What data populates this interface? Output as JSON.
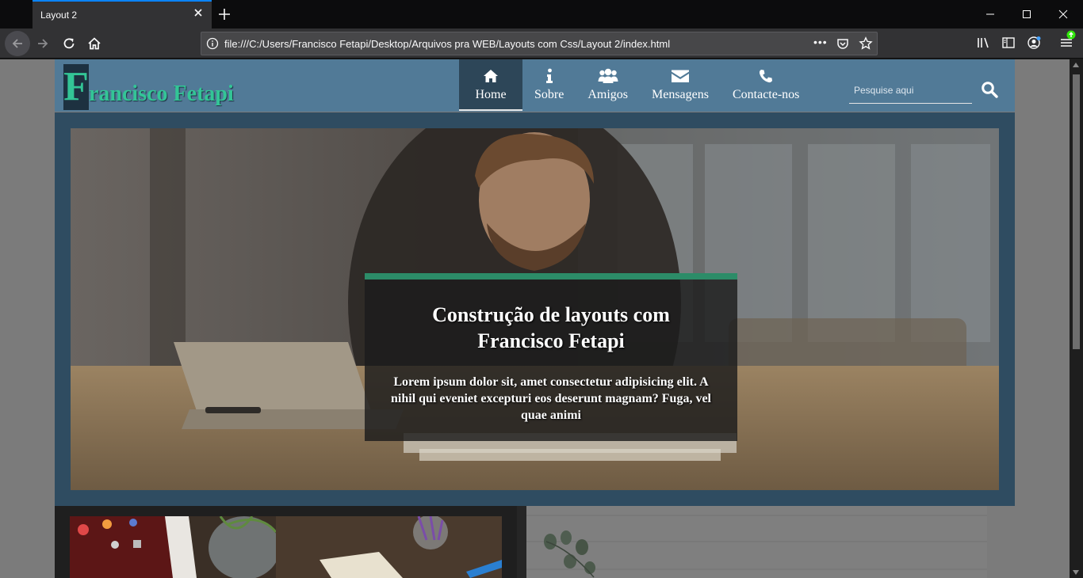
{
  "browser": {
    "tab_title": "Layout 2",
    "url": "file:///C:/Users/Francisco Fetapi/Desktop/Arquivos pra WEB/Layouts com Css/Layout 2/index.html",
    "more_label": "•••"
  },
  "site": {
    "logo_letter": "F",
    "logo_rest": "rancisco Fetapi",
    "menu": [
      {
        "label": "Home",
        "icon": "home-icon",
        "active": true
      },
      {
        "label": "Sobre",
        "icon": "info-icon",
        "active": false
      },
      {
        "label": "Amigos",
        "icon": "users-icon",
        "active": false
      },
      {
        "label": "Mensagens",
        "icon": "envelope-icon",
        "active": false
      },
      {
        "label": "Contacte-nos",
        "icon": "phone-icon",
        "active": false
      }
    ],
    "search_placeholder": "Pesquise aqui",
    "hero": {
      "title": "Construção de layouts com Francisco Fetapi",
      "text": "Lorem ipsum dolor sit, amet consectetur adipisicing elit. A nihil qui eveniet excepturi eos deserunt magnam? Fuga, vel quae animi"
    }
  },
  "colors": {
    "header": "#517a97",
    "logo_accent": "#33c596",
    "caption_bar": "#2c8c68"
  }
}
